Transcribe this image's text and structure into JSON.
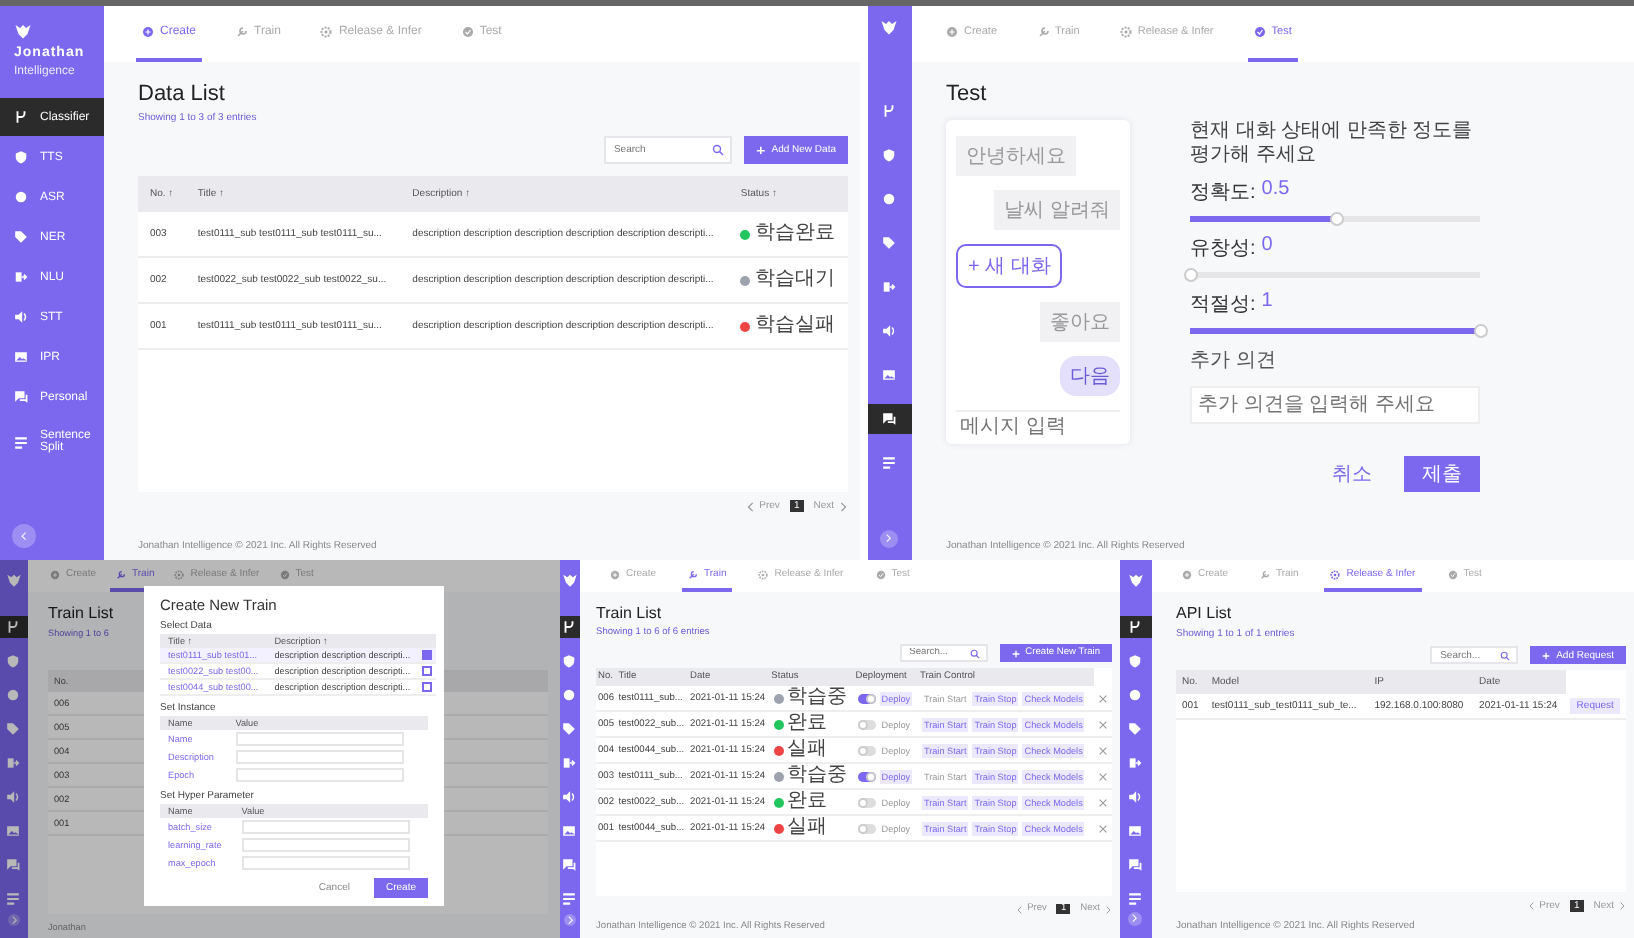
{
  "panels": [
    {
      "kind": "data_list",
      "sidebar": {
        "brand": "Jonathan",
        "brand_sub": "Intelligence",
        "items": [
          {
            "label": "Classifier",
            "selected": true
          },
          {
            "label": "TTS",
            "selected": false
          },
          {
            "label": "ASR",
            "selected": false
          },
          {
            "label": "NER",
            "selected": false
          },
          {
            "label": "NLU",
            "selected": false
          },
          {
            "label": "STT",
            "selected": false
          },
          {
            "label": "IPR",
            "selected": false
          },
          {
            "label": "Personal",
            "selected": false
          },
          {
            "label": "Sentence Split",
            "selected": false
          }
        ]
      },
      "tabs": [
        {
          "label": "Create",
          "selected": true
        },
        {
          "label": "Train",
          "selected": false
        },
        {
          "label": "Release & Infer",
          "selected": false
        },
        {
          "label": "Test",
          "selected": false
        }
      ],
      "title": "Data List",
      "subtitle": "Showing 1 to 3 of 3 entries",
      "search": {
        "placeholder": "Search"
      },
      "add_button": "Add New Data",
      "table": {
        "columns": [
          "No. ↑",
          "Title ↑",
          "Description ↑",
          "Status ↑"
        ],
        "rows": [
          {
            "no": "003",
            "title": "test0111_sub test0111_sub test0111_su...",
            "description": "description description description description description descripti...",
            "status": {
              "label": "학습완료",
              "color": "#22c55e"
            }
          },
          {
            "no": "002",
            "title": "test0022_sub test0022_sub test0022_su...",
            "description": "description description description description description descripti...",
            "status": {
              "label": "학습대기",
              "color": "#9ca3af"
            }
          },
          {
            "no": "001",
            "title": "test0111_sub test0111_sub test0111_su...",
            "description": "description description description description description descripti...",
            "status": {
              "label": "학습실패",
              "color": "#ef4444"
            }
          }
        ]
      },
      "pagination": {
        "prev": "Prev",
        "page": "1",
        "next": "Next"
      },
      "footer": "Jonathan Intelligence © 2021 Inc. All Rights Reserved"
    },
    {
      "kind": "test",
      "sidebar": {
        "items": [
          {
            "selected": false
          },
          {
            "selected": false
          },
          {
            "selected": false
          },
          {
            "selected": false
          },
          {
            "selected": false
          },
          {
            "selected": false
          },
          {
            "selected": false
          },
          {
            "selected": true
          },
          {
            "selected": false
          }
        ]
      },
      "tabs": [
        {
          "label": "Create",
          "selected": false
        },
        {
          "label": "Train",
          "selected": false
        },
        {
          "label": "Release & Infer",
          "selected": false
        },
        {
          "label": "Test",
          "selected": true
        }
      ],
      "title": "Test",
      "chat": {
        "messages": [
          {
            "kind": "received",
            "text": "안녕하세요"
          },
          {
            "kind": "sent",
            "text": "날씨 알려줘"
          },
          {
            "kind": "choice",
            "text": "+ 새 대화"
          },
          {
            "kind": "sent",
            "text": "좋아요"
          },
          {
            "kind": "reply",
            "text": "다음"
          }
        ],
        "input_placeholder": "메시지 입력"
      },
      "question": "현재 대화 상태에 만족한 정도를 평가해 주세요",
      "sliders": [
        {
          "label": "정확도:",
          "reading": "0.5",
          "level": 0.5
        },
        {
          "label": "유창성:",
          "reading": "0",
          "level": 0
        },
        {
          "label": "적절성:",
          "reading": "1",
          "level": 1
        }
      ],
      "comment": {
        "label": "추가 의견",
        "placeholder": "추가 의견을 입력해 주세요"
      },
      "buttons": [
        "취소",
        "제출"
      ],
      "footer": "Jonathan Intelligence © 2021 Inc. All Rights Reserved"
    },
    {
      "kind": "train_modal",
      "sidebar": {
        "items": [
          {
            "selected": true
          },
          {
            "selected": false
          },
          {
            "selected": false
          },
          {
            "selected": false
          },
          {
            "selected": false
          },
          {
            "selected": false
          },
          {
            "selected": false
          },
          {
            "selected": false
          },
          {
            "selected": false
          }
        ]
      },
      "tabs": [
        {
          "label": "Create",
          "selected": false
        },
        {
          "label": "Train",
          "selected": true
        },
        {
          "label": "Release & Infer",
          "selected": false
        },
        {
          "label": "Test",
          "selected": false
        }
      ],
      "title": "Train List",
      "subtitle": "Showing 1 to 6",
      "table": {
        "columns": [
          "No."
        ],
        "rows": [
          {
            "no": "006"
          },
          {
            "no": "005"
          },
          {
            "no": "004"
          },
          {
            "no": "003"
          },
          {
            "no": "002"
          },
          {
            "no": "001"
          }
        ]
      },
      "footer": "Jonathan",
      "modal": {
        "title": "Create New Train",
        "data_section": {
          "label": "Select Data",
          "columns": [
            "Title ↑",
            "Description ↑"
          ],
          "rows": [
            {
              "title": "test0111_sub test01...",
              "description": "description description descripti...",
              "checked": true
            },
            {
              "title": "test0022_sub test00...",
              "description": "description description descripti...",
              "checked": false
            },
            {
              "title": "test0044_sub test00...",
              "description": "description description descripti...",
              "checked": false
            }
          ]
        },
        "instance_section": {
          "label": "Set Instance",
          "columns": [
            "Name",
            "Value"
          ],
          "fields": [
            "Name",
            "Description",
            "Epoch"
          ]
        },
        "hyper_section": {
          "label": "Set Hyper Parameter",
          "columns": [
            "Name",
            "Value"
          ],
          "fields": [
            "batch_size",
            "learning_rate",
            "max_epoch"
          ]
        },
        "buttons": [
          "Cancel",
          "Create"
        ]
      }
    },
    {
      "kind": "train_list",
      "sidebar": {
        "items": [
          {
            "selected": true
          },
          {
            "selected": false
          },
          {
            "selected": false
          },
          {
            "selected": false
          },
          {
            "selected": false
          },
          {
            "selected": false
          },
          {
            "selected": false
          },
          {
            "selected": false
          },
          {
            "selected": false
          }
        ]
      },
      "tabs": [
        {
          "label": "Create",
          "selected": false
        },
        {
          "label": "Train",
          "selected": true
        },
        {
          "label": "Release & Infer",
          "selected": false
        },
        {
          "label": "Test",
          "selected": false
        }
      ],
      "title": "Train List",
      "subtitle": "Showing 1 to 6 of 6 entries",
      "search": {
        "placeholder": "Search..."
      },
      "add_button": "Create New Train",
      "table": {
        "columns": [
          "No.",
          "Title",
          "Date",
          "Status",
          "Deployment",
          "Train Control"
        ],
        "rows": [
          {
            "no": "006",
            "title": "test0111_sub...",
            "date": "2021-01-11 15:24",
            "status": {
              "label": "학습중",
              "color": "#9ca3af"
            },
            "deployed": true,
            "deploy": "Deploy",
            "controls": [
              {
                "label": "Train Start",
                "disabled": true
              },
              {
                "label": "Train Stop",
                "disabled": false
              },
              {
                "label": "Check Models",
                "disabled": false
              }
            ]
          },
          {
            "no": "005",
            "title": "test0022_sub...",
            "date": "2021-01-11 15:24",
            "status": {
              "label": "완료",
              "color": "#22c55e"
            },
            "deployed": false,
            "deploy": "Deploy",
            "controls": [
              {
                "label": "Train Start",
                "disabled": false
              },
              {
                "label": "Train Stop",
                "disabled": false
              },
              {
                "label": "Check Models",
                "disabled": false
              }
            ]
          },
          {
            "no": "004",
            "title": "test0044_sub...",
            "date": "2021-01-11 15:24",
            "status": {
              "label": "실패",
              "color": "#ef4444"
            },
            "deployed": false,
            "deploy": "Deploy",
            "controls": [
              {
                "label": "Train Start",
                "disabled": false
              },
              {
                "label": "Train Stop",
                "disabled": false
              },
              {
                "label": "Check Models",
                "disabled": false
              }
            ]
          },
          {
            "no": "003",
            "title": "test0111_sub...",
            "date": "2021-01-11 15:24",
            "status": {
              "label": "학습중",
              "color": "#9ca3af"
            },
            "deployed": true,
            "deploy": "Deploy",
            "controls": [
              {
                "label": "Train Start",
                "disabled": true
              },
              {
                "label": "Train Stop",
                "disabled": false
              },
              {
                "label": "Check Models",
                "disabled": false
              }
            ]
          },
          {
            "no": "002",
            "title": "test0022_sub...",
            "date": "2021-01-11 15:24",
            "status": {
              "label": "완료",
              "color": "#22c55e"
            },
            "deployed": false,
            "deploy": "Deploy",
            "controls": [
              {
                "label": "Train Start",
                "disabled": false
              },
              {
                "label": "Train Stop",
                "disabled": false
              },
              {
                "label": "Check Models",
                "disabled": false
              }
            ]
          },
          {
            "no": "001",
            "title": "test0044_sub...",
            "date": "2021-01-11 15:24",
            "status": {
              "label": "실패",
              "color": "#ef4444"
            },
            "deployed": false,
            "deploy": "Deploy",
            "controls": [
              {
                "label": "Train Start",
                "disabled": false
              },
              {
                "label": "Train Stop",
                "disabled": false
              },
              {
                "label": "Check Models",
                "disabled": false
              }
            ]
          }
        ]
      },
      "pagination": {
        "prev": "Prev",
        "page": "1",
        "next": "Next"
      },
      "footer": "Jonathan Intelligence © 2021 Inc. All Rights Reserved"
    },
    {
      "kind": "api_list",
      "sidebar": {
        "items": [
          {
            "selected": true
          },
          {
            "selected": false
          },
          {
            "selected": false
          },
          {
            "selected": false
          },
          {
            "selected": false
          },
          {
            "selected": false
          },
          {
            "selected": false
          },
          {
            "selected": false
          },
          {
            "selected": false
          }
        ]
      },
      "tabs": [
        {
          "label": "Create",
          "selected": false
        },
        {
          "label": "Train",
          "selected": false
        },
        {
          "label": "Release & Infer",
          "selected": true
        },
        {
          "label": "Test",
          "selected": false
        }
      ],
      "title": "API List",
      "subtitle": "Showing 1 to 1 of 1 entries",
      "search": {
        "placeholder": "Search..."
      },
      "add_button": "Add Request",
      "table": {
        "columns": [
          "No.",
          "Model",
          "IP",
          "Date"
        ],
        "rows": [
          {
            "no": "001",
            "model": "test0111_sub_test0111_sub_te...",
            "ip": "192.168.0.100:8080",
            "date": "2021-01-11 15:24",
            "action": "Request"
          }
        ]
      },
      "pagination": {
        "prev": "Prev",
        "page": "1",
        "next": "Next"
      },
      "footer": "Jonathan Intelligence © 2021 Inc. All Rights Reserved"
    }
  ]
}
